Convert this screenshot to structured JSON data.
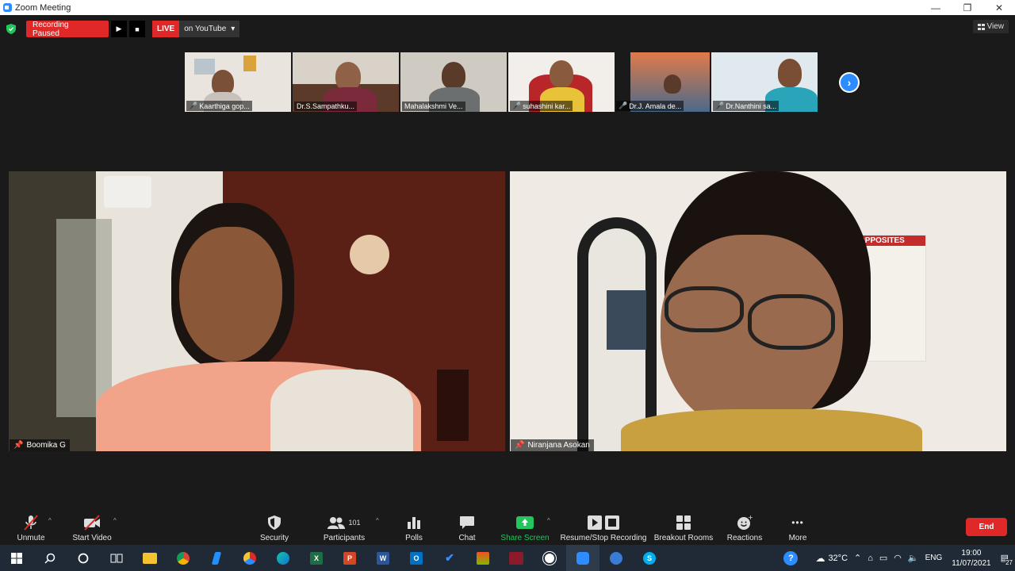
{
  "window": {
    "title": "Zoom Meeting",
    "minimize": "—",
    "maximize": "❐",
    "close": "✕"
  },
  "recording": {
    "status": "Recording Paused",
    "play": "▶",
    "stop": "■"
  },
  "live": {
    "badge": "LIVE",
    "platform": "on YouTube",
    "caret": "▾"
  },
  "view_button": {
    "label": "View"
  },
  "thumbnails": [
    {
      "name": "Kaarthiga gop...",
      "muted": true
    },
    {
      "name": "Dr.S.Sampathku...",
      "muted": false
    },
    {
      "name": "Mahalakshmi Ve...",
      "muted": false
    },
    {
      "name": "suhashini kar...",
      "muted": true
    },
    {
      "name": "Dr.J. Amala de...",
      "muted": true
    },
    {
      "name": "Dr.Nanthini sa...",
      "muted": true
    }
  ],
  "next_arrow": "›",
  "videos": [
    {
      "name": "Boomika G"
    },
    {
      "name": "Niranjana Asokan"
    }
  ],
  "poster_text": "OPPOSITES",
  "toolbar": {
    "unmute": "Unmute",
    "start_video": "Start Video",
    "security": "Security",
    "participants": "Participants",
    "participants_count": "101",
    "polls": "Polls",
    "chat": "Chat",
    "share_screen": "Share Screen",
    "resume_stop_recording": "Resume/Stop Recording",
    "breakout_rooms": "Breakout Rooms",
    "reactions": "Reactions",
    "more": "More",
    "more_dots": "•••",
    "end": "End",
    "caret": "^"
  },
  "taskbar": {
    "weather": "32°C",
    "language": "ENG",
    "time": "19:00",
    "date": "11/07/2021",
    "notifications": "27",
    "help": "?",
    "apps": [
      {
        "name": "excel",
        "glyph": "X",
        "color": "#1d6f42"
      },
      {
        "name": "powerpoint",
        "glyph": "P",
        "color": "#d24726"
      },
      {
        "name": "word",
        "glyph": "W",
        "color": "#2b579a"
      },
      {
        "name": "outlook",
        "glyph": "O",
        "color": "#0072c6"
      },
      {
        "name": "skype",
        "glyph": "S",
        "color": "#00aff0"
      }
    ]
  },
  "colors": {
    "accent": "#2d8cff",
    "danger": "#e02828",
    "share_green": "#23c55e",
    "bg": "#1a1a1a"
  }
}
